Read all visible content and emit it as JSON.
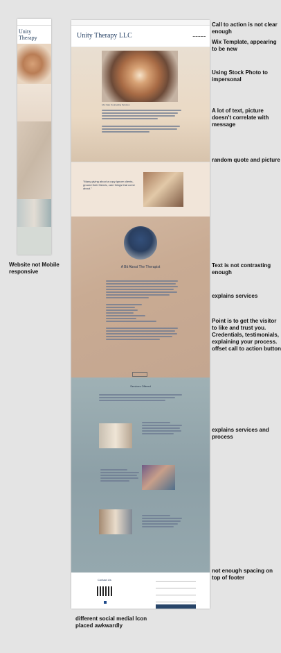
{
  "mobile": {
    "site_title": "Unity Therapy"
  },
  "desktop": {
    "site_title": "Unity Therapy LLC",
    "hero_sub": "Life Care Counseling Services",
    "quote_text": "\"Many giving about a copy ignore clients, ground their friends, care things that come about.\"",
    "about_title": "A Bit About The Therapist",
    "services_title": "Services Offered",
    "footer_title": "Contact Us"
  },
  "annotations": {
    "a1": "Call to action is not clear enough",
    "a2": "Wix Template, appearing to be new",
    "a3": "Using Stock Photo to impersonal",
    "a4": "A lot of text, picture doesn't correlate with message",
    "a5": "random quote and picture",
    "a6": "Website not Mobile responsive",
    "a7": "Text is not contrasting enough",
    "a8": "explains services",
    "a9": "Point is to get the visitor to like and trust you. Credentials, testimonials, explaining your process. offset call to action button",
    "a10": "explains services and process",
    "a11": "not enough spacing on top of footer",
    "a12": "different social medial Icon placed awkwardly"
  }
}
